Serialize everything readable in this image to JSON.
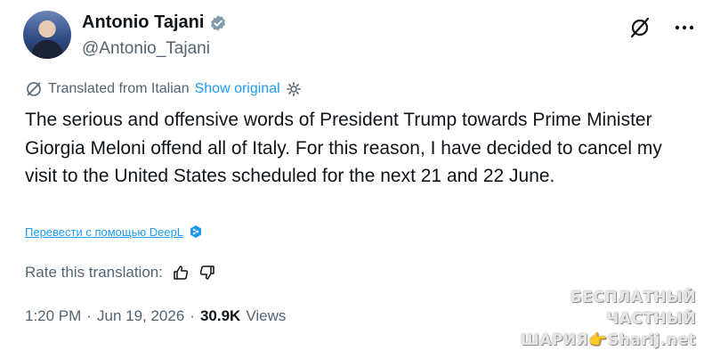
{
  "author": {
    "name": "Antonio Tajani",
    "handle": "@Antonio_Tajani"
  },
  "translation": {
    "label": "Translated from Italian",
    "show_original": "Show original",
    "deepl_link": "Перевести с помощью DeepL",
    "rate_label": "Rate this translation:"
  },
  "tweet": {
    "text": "The serious and offensive words of President Trump towards Prime Minister Giorgia Meloni offend all of Italy. For this reason, I have decided to cancel my visit to the United States scheduled for the next 21 and 22 June."
  },
  "meta": {
    "time": "1:20 PM",
    "date": "Jun 19, 2026",
    "views_count": "30.9K",
    "views_label": "Views",
    "separator": "·"
  },
  "watermark": {
    "line1": "БЕСПЛАТНЫЙ ЧАСТНЫЙ",
    "line2": "ШАРИЯ👉Sharij.net"
  },
  "colors": {
    "accent": "#1d9bf0",
    "secondary_text": "#536471",
    "primary_text": "#0f1419"
  },
  "icons": {
    "verified": "verified-badge-icon",
    "grok": "grok-icon",
    "more": "more-icon",
    "globe": "translate-globe-icon",
    "settings": "settings-icon",
    "deepl": "deepl-icon",
    "thumb_up": "thumbs-up-icon",
    "thumb_down": "thumbs-down-icon"
  }
}
